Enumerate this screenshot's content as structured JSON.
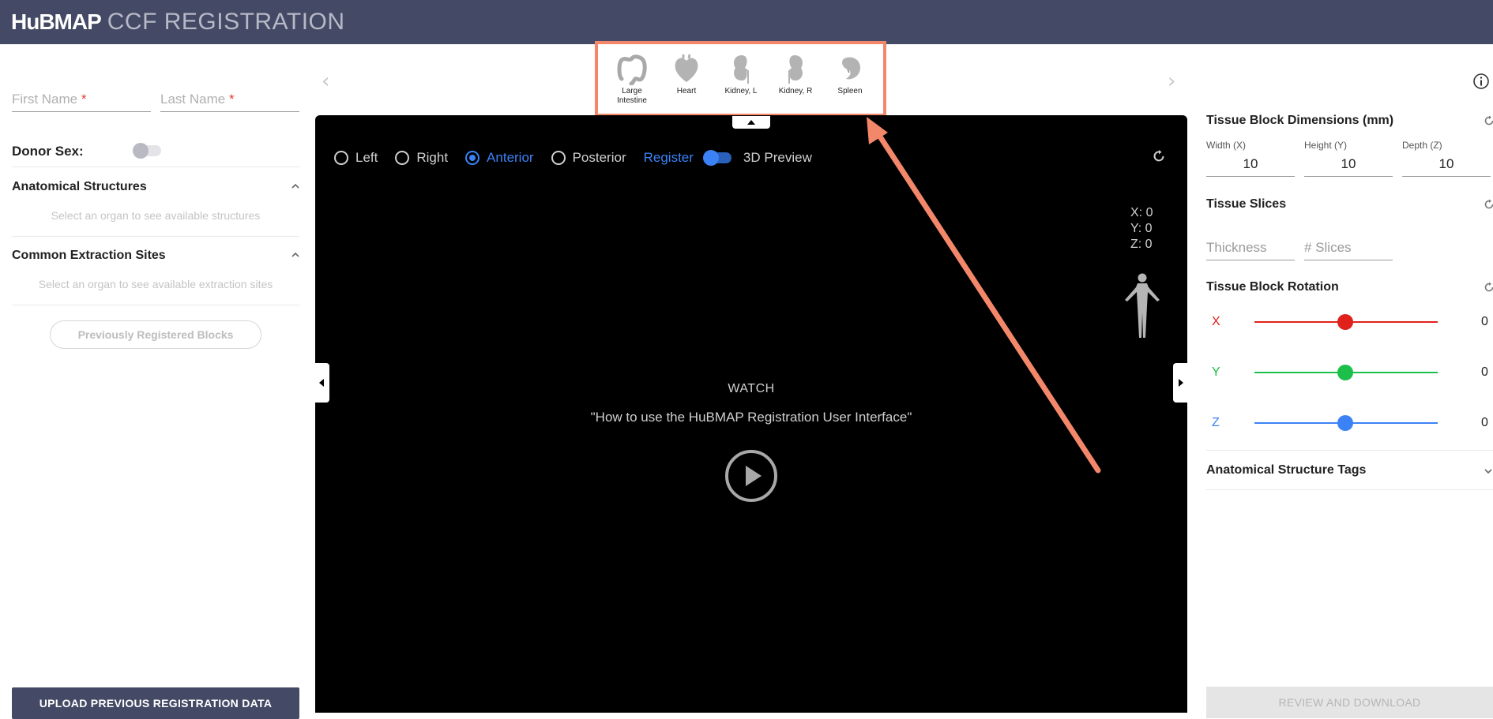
{
  "header": {
    "logo": "HuBMAP",
    "title": "CCF REGISTRATION"
  },
  "left_panel": {
    "first_name_placeholder": "First Name",
    "last_name_placeholder": "Last Name",
    "required_mark": "*",
    "donor_sex_label": "Donor Sex:",
    "donor_sex_toggle": "off",
    "anatomical_structures": {
      "title": "Anatomical Structures",
      "hint": "Select an organ to see available structures"
    },
    "extraction_sites": {
      "title": "Common Extraction Sites",
      "hint": "Select an organ to see available extraction sites"
    },
    "previous_blocks_button": "Previously Registered Blocks",
    "upload_button": "UPLOAD PREVIOUS REGISTRATION DATA"
  },
  "organ_carousel": {
    "prev_arrow": "‹",
    "next_arrow": "›",
    "organs": [
      {
        "label": "Large Intestine",
        "icon": "large-intestine-icon"
      },
      {
        "label": "Heart",
        "icon": "heart-icon"
      },
      {
        "label": "Kidney, L",
        "icon": "kidney-left-icon"
      },
      {
        "label": "Kidney, R",
        "icon": "kidney-right-icon"
      },
      {
        "label": "Spleen",
        "icon": "spleen-icon"
      }
    ],
    "highlight_color": "#f3876a"
  },
  "stage": {
    "views": [
      {
        "label": "Left",
        "selected": false
      },
      {
        "label": "Right",
        "selected": false
      },
      {
        "label": "Anterior",
        "selected": true
      },
      {
        "label": "Posterior",
        "selected": false
      }
    ],
    "register_label": "Register",
    "preview_label": "3D Preview",
    "coords": {
      "x": "X: 0",
      "y": "Y: 0",
      "z": "Z: 0"
    },
    "watch_label": "WATCH",
    "video_title": "\"How to use the HuBMAP Registration User Interface\""
  },
  "right_panel": {
    "dimensions": {
      "title": "Tissue Block Dimensions (mm)",
      "width_label": "Width (X)",
      "width_value": "10",
      "height_label": "Height (Y)",
      "height_value": "10",
      "depth_label": "Depth (Z)",
      "depth_value": "10"
    },
    "slices": {
      "title": "Tissue Slices",
      "thickness_placeholder": "Thickness",
      "slices_placeholder": "# Slices"
    },
    "rotation": {
      "title": "Tissue Block Rotation",
      "axes": [
        {
          "label": "X",
          "value": "0",
          "color": "#e0201b"
        },
        {
          "label": "Y",
          "value": "0",
          "color": "#1bbf4a"
        },
        {
          "label": "Z",
          "value": "0",
          "color": "#3b82f6"
        }
      ]
    },
    "tags_title": "Anatomical Structure Tags",
    "review_button": "REVIEW AND DOWNLOAD"
  },
  "colors": {
    "header_bg": "#444a65",
    "accent_blue": "#3b82f6",
    "annotation": "#f3876a"
  }
}
